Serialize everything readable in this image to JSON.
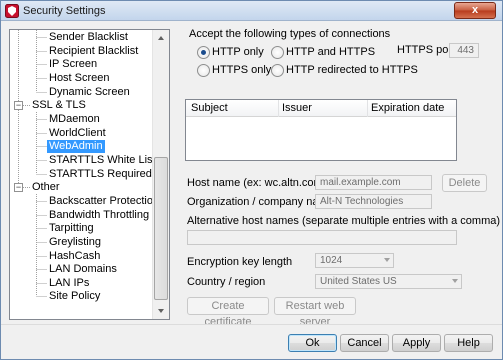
{
  "window": {
    "title": "Security Settings",
    "close_glyph": "x"
  },
  "tree": {
    "items": [
      {
        "label": "Sender Blacklist"
      },
      {
        "label": "Recipient Blacklist"
      },
      {
        "label": "IP Screen"
      },
      {
        "label": "Host Screen"
      },
      {
        "label": "Dynamic Screen"
      },
      {
        "label": "SSL & TLS",
        "expander": "−"
      },
      {
        "label": "MDaemon"
      },
      {
        "label": "WorldClient"
      },
      {
        "label": "WebAdmin",
        "selected": true
      },
      {
        "label": "STARTTLS White List"
      },
      {
        "label": "STARTTLS Required List"
      },
      {
        "label": "Other",
        "expander": "−"
      },
      {
        "label": "Backscatter Protection"
      },
      {
        "label": "Bandwidth Throttling"
      },
      {
        "label": "Tarpitting"
      },
      {
        "label": "Greylisting"
      },
      {
        "label": "HashCash"
      },
      {
        "label": "LAN Domains"
      },
      {
        "label": "LAN IPs"
      },
      {
        "label": "Site Policy"
      }
    ]
  },
  "connections": {
    "group_label": "Accept the following types of connections",
    "options": [
      {
        "label": "HTTP only",
        "checked": true
      },
      {
        "label": "HTTP and HTTPS",
        "checked": false
      },
      {
        "label": "HTTPS only",
        "checked": false
      },
      {
        "label": "HTTP redirected to HTTPS",
        "checked": false
      }
    ],
    "https_port_label": "HTTPS port",
    "https_port_value": "443"
  },
  "certificates": {
    "columns": [
      "Subject",
      "Issuer",
      "Expiration date"
    ]
  },
  "form": {
    "host_name_label": "Host name (ex: wc.altn.com)",
    "host_name_value": "mail.example.com",
    "delete_label": "Delete",
    "org_label": "Organization / company name",
    "org_value": "Alt-N Technologies",
    "alt_hosts_label": "Alternative host names (separate multiple entries with a comma)",
    "alt_hosts_value": "",
    "key_length_label": "Encryption key length",
    "key_length_value": "1024",
    "country_label": "Country / region",
    "country_value": "United States US",
    "create_cert_label": "Create certificate",
    "restart_label": "Restart web server"
  },
  "footer": {
    "ok": "Ok",
    "cancel": "Cancel",
    "apply": "Apply",
    "help": "Help"
  }
}
